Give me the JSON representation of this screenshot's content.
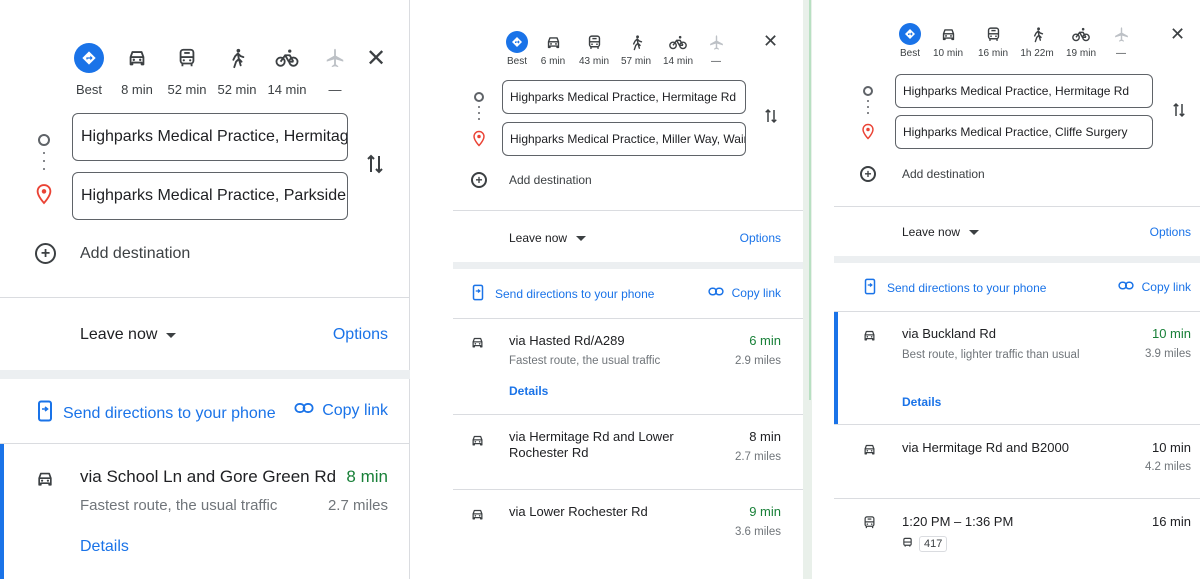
{
  "colors": {
    "accent": "#1a73e8",
    "green": "#188038",
    "destination_pin": "#ea4335",
    "text": "#202124",
    "muted": "#70757a"
  },
  "panel1": {
    "modes": [
      {
        "icon": "best-route-icon",
        "label": "Best",
        "selected": true
      },
      {
        "icon": "car-icon",
        "label": "8 min"
      },
      {
        "icon": "transit-icon",
        "label": "52 min"
      },
      {
        "icon": "walk-icon",
        "label": "52 min"
      },
      {
        "icon": "bicycle-icon",
        "label": "14 min"
      },
      {
        "icon": "flight-icon",
        "label": "—"
      }
    ],
    "origin": "Highparks Medical Practice, Hermitage Rd",
    "destination": "Highparks Medical Practice, Parkside, Cliffe",
    "add_destination": "Add destination",
    "leave_now": "Leave now",
    "options": "Options",
    "send_to_phone": "Send directions to your phone",
    "copy_link": "Copy link",
    "routes": [
      {
        "mode": "car-icon",
        "title": "via School Ln and Gore Green Rd",
        "subtitle": "Fastest route, the usual traffic",
        "time": "8 min",
        "distance": "2.7 miles",
        "details": "Details"
      }
    ]
  },
  "panel2": {
    "modes": [
      {
        "icon": "best-route-icon",
        "label": "Best",
        "selected": true
      },
      {
        "icon": "car-icon",
        "label": "6 min"
      },
      {
        "icon": "transit-icon",
        "label": "43 min"
      },
      {
        "icon": "walk-icon",
        "label": "57 min"
      },
      {
        "icon": "bicycle-icon",
        "label": "14 min"
      },
      {
        "icon": "flight-icon",
        "label": "—"
      }
    ],
    "origin": "Highparks Medical Practice, Hermitage Rd",
    "destination": "Highparks Medical Practice, Miller Way, Wainscott",
    "add_destination": "Add destination",
    "leave_now": "Leave now",
    "options": "Options",
    "send_to_phone": "Send directions to your phone",
    "copy_link": "Copy link",
    "routes": [
      {
        "mode": "car-icon",
        "title": "via Hasted Rd/A289",
        "subtitle": "Fastest route, the usual traffic",
        "time": "6 min",
        "distance": "2.9 miles",
        "details": "Details"
      },
      {
        "mode": "car-icon",
        "title": "via Hermitage Rd and Lower Rochester Rd",
        "time": "8 min",
        "distance": "2.7 miles"
      },
      {
        "mode": "car-icon",
        "title": "via Lower Rochester Rd",
        "time": "9 min",
        "distance": "3.6 miles"
      }
    ]
  },
  "panel3": {
    "modes": [
      {
        "icon": "best-route-icon",
        "label": "Best",
        "selected": true
      },
      {
        "icon": "car-icon",
        "label": "10 min"
      },
      {
        "icon": "transit-icon",
        "label": "16 min"
      },
      {
        "icon": "walk-icon",
        "label": "1h 22m"
      },
      {
        "icon": "bicycle-icon",
        "label": "19 min"
      },
      {
        "icon": "flight-icon",
        "label": "—"
      }
    ],
    "origin": "Highparks Medical Practice, Hermitage Rd",
    "destination": "Highparks Medical Practice, Cliffe Surgery",
    "add_destination": "Add destination",
    "leave_now": "Leave now",
    "options": "Options",
    "send_to_phone": "Send directions to your phone",
    "copy_link": "Copy link",
    "routes": [
      {
        "mode": "car-icon",
        "title": "via Buckland Rd",
        "subtitle": "Best route, lighter traffic than usual",
        "time": "10 min",
        "distance": "3.9 miles",
        "details": "Details"
      },
      {
        "mode": "car-icon",
        "title": "via Hermitage Rd and B2000",
        "time": "10 min",
        "distance": "4.2 miles"
      },
      {
        "mode": "transit-icon",
        "title": "1:20 PM – 1:36 PM",
        "time": "16 min",
        "bus_icon": "bus-icon",
        "bus_number": "417"
      }
    ]
  }
}
